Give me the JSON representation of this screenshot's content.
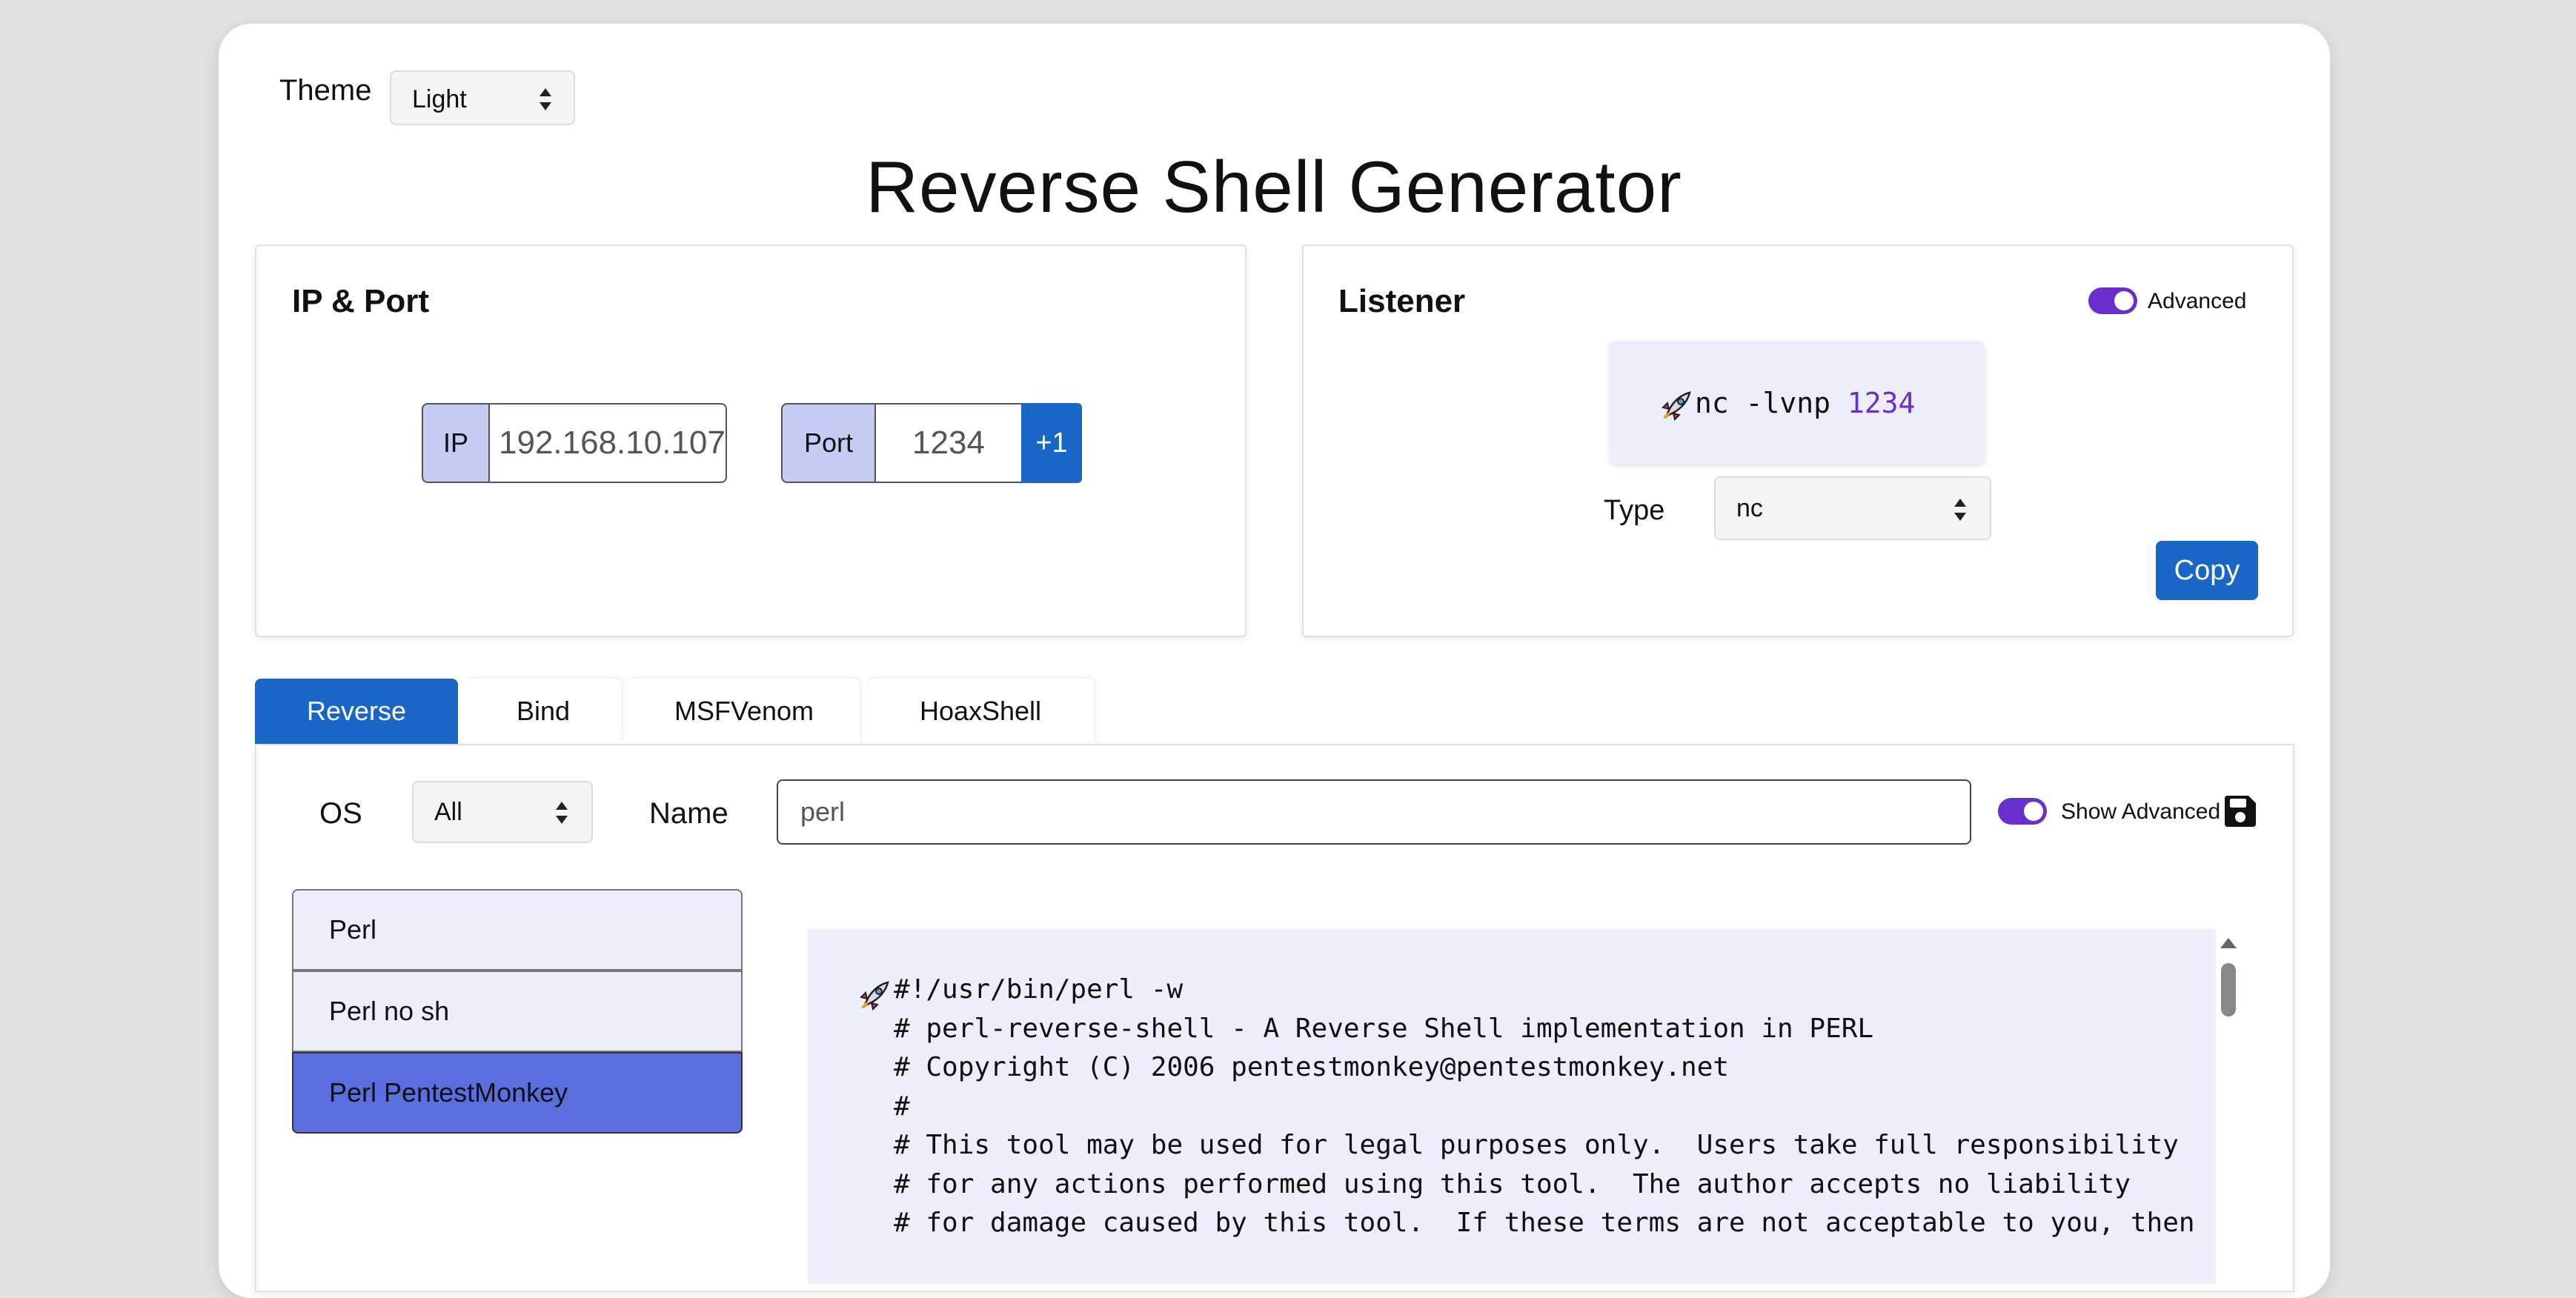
{
  "theme": {
    "label": "Theme",
    "selected": "Light"
  },
  "title": "Reverse Shell Generator",
  "ip_port": {
    "title": "IP & Port",
    "ip_label": "IP",
    "ip_value": "192.168.10.107",
    "port_label": "Port",
    "port_value": "1234",
    "increment_label": "+1"
  },
  "listener": {
    "title": "Listener",
    "advanced_label": "Advanced",
    "advanced_on": true,
    "command_prefix": "nc -lvnp ",
    "command_port": "1234",
    "type_label": "Type",
    "type_selected": "nc",
    "copy_label": "Copy"
  },
  "tabs": [
    {
      "label": "Reverse",
      "active": true
    },
    {
      "label": "Bind",
      "active": false
    },
    {
      "label": "MSFVenom",
      "active": false
    },
    {
      "label": "HoaxShell",
      "active": false
    }
  ],
  "filters": {
    "os_label": "OS",
    "os_selected": "All",
    "name_label": "Name",
    "name_value": "perl",
    "show_advanced_label": "Show Advanced",
    "show_advanced_on": true
  },
  "shell_list": [
    {
      "label": "Perl",
      "selected": false
    },
    {
      "label": "Perl no sh",
      "selected": false
    },
    {
      "label": "Perl PentestMonkey",
      "selected": true
    }
  ],
  "code_lines": [
    "#!/usr/bin/perl -w",
    "# perl-reverse-shell - A Reverse Shell implementation in PERL",
    "# Copyright (C) 2006 pentestmonkey@pentestmonkey.net",
    "#",
    "# This tool may be used for legal purposes only.  Users take full responsibility",
    "# for any actions performed using this tool.  The author accepts no liability",
    "# for damage caused by this tool.  If these terms are not acceptable to you, then"
  ],
  "colors": {
    "accent": "#1a66c6",
    "toggle": "#6a2ecf",
    "selected_item": "#5a6ee0",
    "label_bg": "#c5cbf3"
  }
}
